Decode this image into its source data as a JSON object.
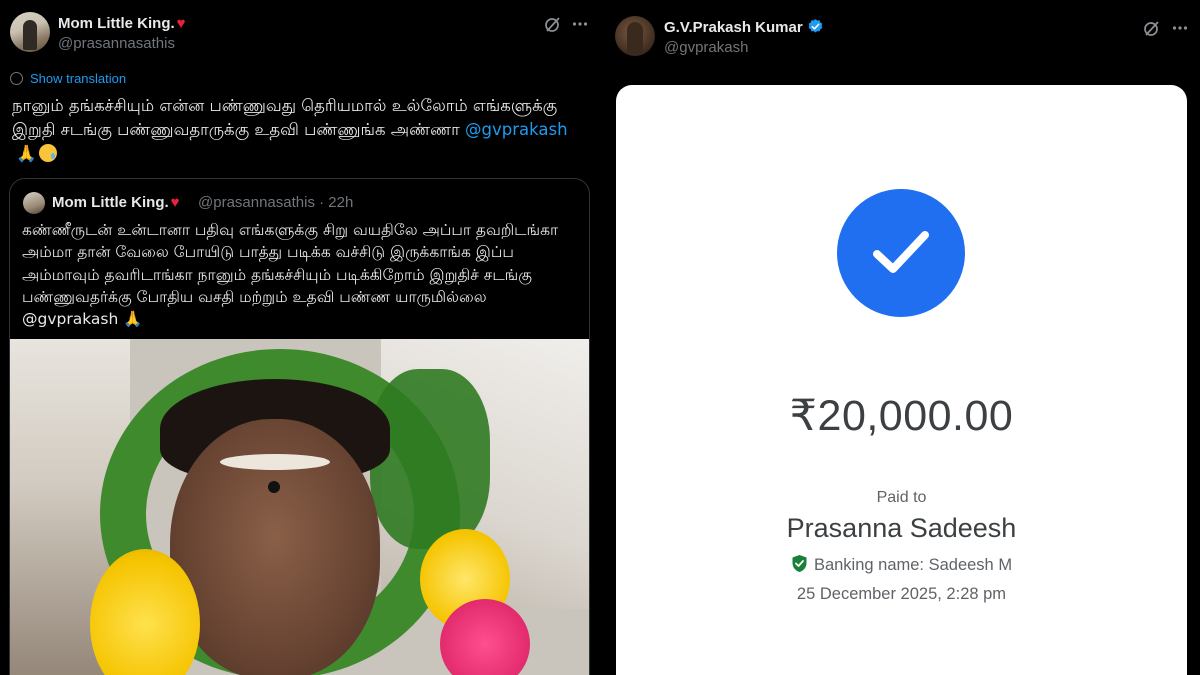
{
  "left_tweet": {
    "author_name": "Mom Little King.",
    "author_heart": "♥",
    "author_handle": "@prasannasathis",
    "show_translation": "Show translation",
    "text_main": "நானும் தங்கச்சியும் என்ன பண்ணுவது தெரியமால் உல்லோம் எங்களுக்கு இறுதி சடங்கு பண்ணுவதாருக்கு உதவி பண்ணுங்க அண்ணா ",
    "text_mention": "@gvprakash",
    "emoji_pray": "🙏",
    "icons": {
      "grok": "grok-icon",
      "more": "more-dots-icon",
      "translate": "globe-icon"
    },
    "quote": {
      "author_name": "Mom Little King.",
      "author_heart": "♥",
      "author_handle": "@prasannasathis · 22h",
      "text": "கண்ணீருடன் உன்டானா பதிவு எங்களுக்கு சிறு வயதிலே அப்பா தவறிடங்கா அம்மா தான் வேலை போயிடு பாத்து படிக்க வச்சிடு இருக்காங்க இப்ப அம்மாவும் தவரிடாங்கா நானும் தங்கச்சியும் படிக்கிறோம் இறுதிச் சடங்கு பண்ணுவதர்க்கு போதிய வசதி மற்றும் உதவி பண்ண யாருமில்லை @gvprakash 🙏"
    }
  },
  "right_tweet": {
    "author_name": "G.V.Prakash Kumar",
    "author_handle": "@gvprakash",
    "icons": {
      "verified": "verified-badge-icon",
      "grok": "grok-icon",
      "more": "more-dots-icon"
    },
    "receipt": {
      "amount": "₹20,000.00",
      "paid_to_label": "Paid to",
      "payee": "Prasanna Sadeesh",
      "banking_name": "Banking name: Sadeesh  M",
      "date": "25 December 2025, 2:28 pm",
      "icons": {
        "success": "check-circle-icon",
        "shield": "shield-check-icon"
      }
    }
  },
  "colors": {
    "background": "#000000",
    "link": "#1d9bf0",
    "success_blue": "#1f6ff0",
    "shield_green": "#188038",
    "heart_red": "#e8213c"
  }
}
